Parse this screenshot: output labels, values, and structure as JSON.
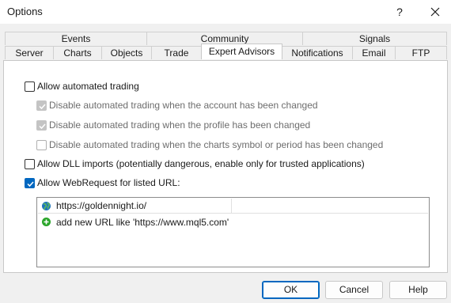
{
  "window": {
    "title": "Options",
    "help_glyph": "?",
    "close_icon": "close-icon"
  },
  "tabs": {
    "row1": [
      "Events",
      "Community",
      "Signals"
    ],
    "row2": [
      "Server",
      "Charts",
      "Objects",
      "Trade",
      "Expert Advisors",
      "Notifications",
      "Email",
      "FTP"
    ],
    "active": "Expert Advisors"
  },
  "options": {
    "allow_automated": {
      "label": "Allow automated trading",
      "checked": false
    },
    "disable_account": {
      "label": "Disable automated trading when the account has been changed",
      "checked": true,
      "enabled": false
    },
    "disable_profile": {
      "label": "Disable automated trading when the profile has been changed",
      "checked": true,
      "enabled": false
    },
    "disable_symbol": {
      "label": "Disable automated trading when the charts symbol or period has been changed",
      "checked": false,
      "enabled": false
    },
    "allow_dll": {
      "label": "Allow DLL imports (potentially dangerous, enable only for trusted applications)",
      "checked": false
    },
    "allow_webrequest": {
      "label": "Allow WebRequest for listed URL:",
      "checked": true
    }
  },
  "url_list": {
    "items": [
      {
        "text": "https://goldennight.io/",
        "icon": "globe-icon"
      },
      {
        "text": "add new URL like 'https://www.mql5.com'",
        "icon": "add-icon"
      }
    ]
  },
  "buttons": {
    "ok": "OK",
    "cancel": "Cancel",
    "help": "Help"
  },
  "colors": {
    "accent": "#0067c0",
    "add_green": "#2aa52a",
    "globe_blue": "#1e73be"
  }
}
